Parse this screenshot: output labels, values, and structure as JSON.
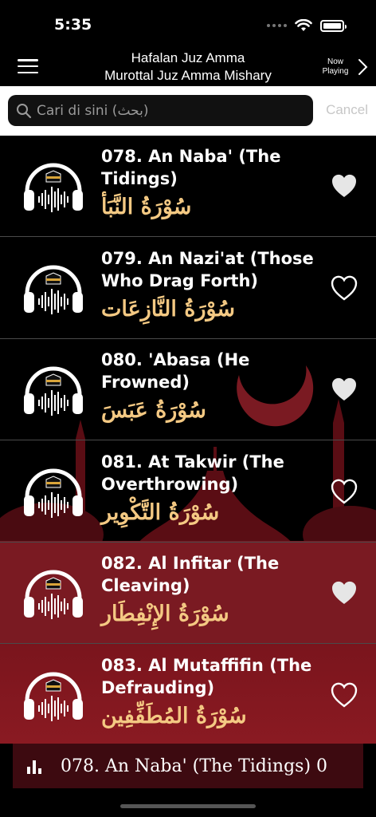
{
  "status": {
    "time": "5:35"
  },
  "nav": {
    "title_line1": "Hafalan Juz Amma",
    "title_line2": "Murottal Juz Amma Mishary",
    "now_playing_line1": "Now",
    "now_playing_line2": "Playing"
  },
  "search": {
    "placeholder": "Cari di sini (بحث)",
    "value": "",
    "cancel_label": "Cancel"
  },
  "items": [
    {
      "title": "078. An Naba' (The Tidings)",
      "arabic": "سُوْرَةُ النَّبَأ",
      "favorite": true
    },
    {
      "title": "079. An Nazi'at (Those Who Drag Forth)",
      "arabic": "سُوْرَةُ النَّازِعَات",
      "favorite": false
    },
    {
      "title": "080. 'Abasa (He Frowned)",
      "arabic": "سُوْرَةُ عَبَسَ",
      "favorite": true
    },
    {
      "title": "081. At Takwir (The Overthrowing)",
      "arabic": "سُوْرَةُ التَّكْوِير",
      "favorite": false
    },
    {
      "title": "082. Al Infitar (The Cleaving)",
      "arabic": "سُوْرَةُ الإِنْفِطَار",
      "favorite": true
    },
    {
      "title": "083. Al Mutaffifin (The Defrauding)",
      "arabic": "سُوْرَةُ المُطَفِّفِين",
      "favorite": false
    }
  ],
  "player": {
    "track": "078. An Naba' (The Tidings)   0"
  },
  "colors": {
    "arabic_text": "#f4c983",
    "row_highlight": "#7a1a22",
    "player_bg": "#3d0a10"
  },
  "icons": [
    "menu-icon",
    "chevron-right-icon",
    "search-icon",
    "headphones-icon",
    "heart-icon",
    "equalizer-icon"
  ]
}
